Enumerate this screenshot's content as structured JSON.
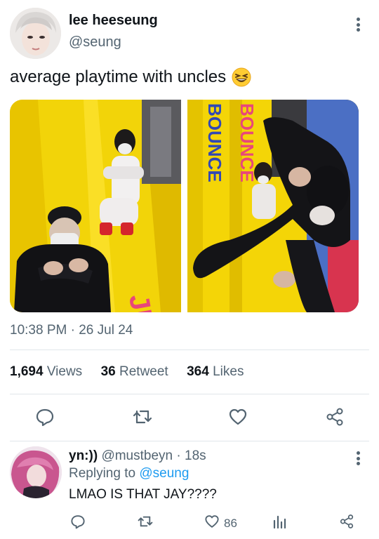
{
  "tweet": {
    "author_name": "lee heeseung",
    "author_handle": "@seung",
    "text": "average playtime with uncles",
    "emoji": "grinning-squinting-face",
    "timestamp": "10:38 PM · 26 Jul 24",
    "stats": {
      "views_count": "1,694",
      "views_label": "Views",
      "retweets_count": "36",
      "retweets_label": "Retweet",
      "likes_count": "364",
      "likes_label": "Likes"
    },
    "photo_text": {
      "slide_sign_left": "JUNC!",
      "slide_sign_right_a": "BOUNCE",
      "slide_sign_right_b": "BOUNCE"
    },
    "actions": [
      "reply-icon",
      "retweet-icon",
      "like-icon",
      "share-icon"
    ]
  },
  "reply": {
    "author_name": "yn:))",
    "author_handle": "@mustbeyn",
    "time": "· 18s",
    "replying_prefix": "Replying to",
    "replying_to": "@seung",
    "text": "LMAO IS THAT JAY????",
    "likes_count": "86",
    "actions": [
      "reply-icon",
      "retweet-icon",
      "like-icon",
      "views-icon",
      "share-icon"
    ]
  },
  "colors": {
    "text_primary": "#0f1419",
    "text_secondary": "#536471",
    "link_blue": "#1d9bf0",
    "divider": "#e1e6ea",
    "slide_yellow": "#f5d60a"
  }
}
